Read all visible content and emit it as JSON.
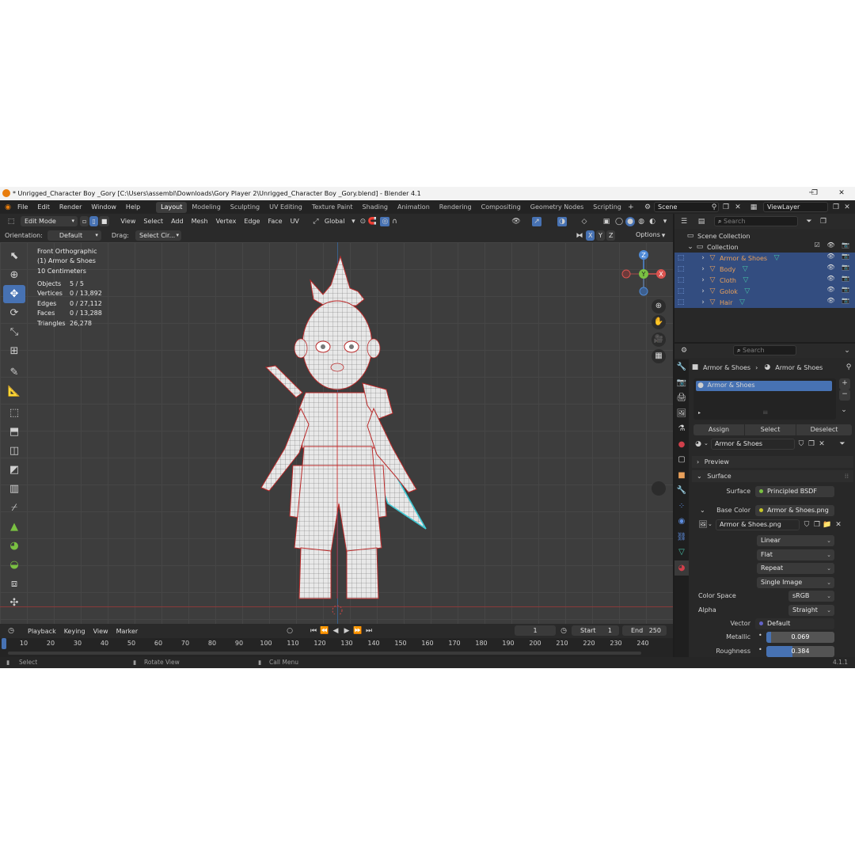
{
  "window": {
    "title": "* Unrigged_Character Boy _Gory [C:\\Users\\assembl\\Downloads\\Gory Player 2\\Unrigged_Character Boy _Gory.blend] - Blender 4.1",
    "minimize": "─",
    "maximize": "❐",
    "close": "✕"
  },
  "menu": [
    "File",
    "Edit",
    "Render",
    "Window",
    "Help"
  ],
  "workspaces": [
    "Layout",
    "Modeling",
    "Sculpting",
    "UV Editing",
    "Texture Paint",
    "Shading",
    "Animation",
    "Rendering",
    "Compositing",
    "Geometry Nodes",
    "Scripting"
  ],
  "active_workspace": "Layout",
  "scene": "Scene",
  "view_layer": "ViewLayer",
  "viewport_header": {
    "mode": "Edit Mode",
    "menus": [
      "View",
      "Select",
      "Add",
      "Mesh",
      "Vertex",
      "Edge",
      "Face",
      "UV"
    ],
    "transform": "Global",
    "orientation_label": "Orientation:",
    "orientation_value": "Default",
    "drag_label": "Drag:",
    "drag_value": "Select Cir...",
    "axes": [
      "X",
      "Y",
      "Z"
    ],
    "options": "Options"
  },
  "viewport_overlay": {
    "view_name": "Front Orthographic",
    "object_name": "(1) Armor & Shoes",
    "scale": "10 Centimeters"
  },
  "stats": [
    {
      "label": "Objects",
      "value": "5 / 5"
    },
    {
      "label": "Vertices",
      "value": "0 / 13,892"
    },
    {
      "label": "Edges",
      "value": "0 / 27,112"
    },
    {
      "label": "Faces",
      "value": "0 / 13,288"
    },
    {
      "label": "Triangles",
      "value": "26,278"
    }
  ],
  "gizmo": {
    "x": "X",
    "y": "Y",
    "z": "Z"
  },
  "timeline": {
    "menus": [
      "Playback",
      "Keying",
      "View",
      "Marker"
    ],
    "current_frame": "1",
    "start_label": "Start",
    "start": "1",
    "end_label": "End",
    "end": "250",
    "ruler": [
      "10",
      "20",
      "30",
      "40",
      "50",
      "60",
      "70",
      "80",
      "90",
      "100",
      "110",
      "120",
      "130",
      "140",
      "150",
      "160",
      "170",
      "180",
      "190",
      "200",
      "210",
      "220",
      "230",
      "240"
    ]
  },
  "status_bar": {
    "select": "Select",
    "rotate": "Rotate View",
    "call_menu": "Call Menu",
    "version": "4.1.1"
  },
  "outliner": {
    "search_placeholder": "Search",
    "root": "Scene Collection",
    "collection": "Collection",
    "items": [
      "Armor & Shoes",
      "Body",
      "Cloth",
      "Golok",
      "Hair"
    ]
  },
  "properties": {
    "search_placeholder": "Search",
    "breadcrumb_object": "Armor & Shoes",
    "breadcrumb_material": "Armor & Shoes",
    "slot": "Armor & Shoes",
    "assign": "Assign",
    "select": "Select",
    "deselect": "Deselect",
    "material_name": "Armor & Shoes",
    "preview": "Preview",
    "surface_panel": "Surface",
    "surface_label": "Surface",
    "surface_value": "Principled BSDF",
    "base_color_label": "Base Color",
    "base_color_value": "Armor & Shoes.png",
    "image_name": "Armor & Shoes.png",
    "interpolation": "Linear",
    "projection": "Flat",
    "extension": "Repeat",
    "source": "Single Image",
    "color_space_label": "Color Space",
    "color_space": "sRGB",
    "alpha_label": "Alpha",
    "alpha": "Straight",
    "vector_label": "Vector",
    "vector": "Default",
    "metallic_label": "Metallic",
    "metallic": 0.069,
    "metallic_text": "0.069",
    "roughness_label": "Roughness",
    "roughness": 0.384,
    "roughness_text": "0.384"
  },
  "colors": {
    "accent": "#4772b3",
    "selection": "#334d80",
    "object_name": "#e9a05a",
    "wire_seam": "#cc2222",
    "wire_selected": "#3fc9d4"
  }
}
